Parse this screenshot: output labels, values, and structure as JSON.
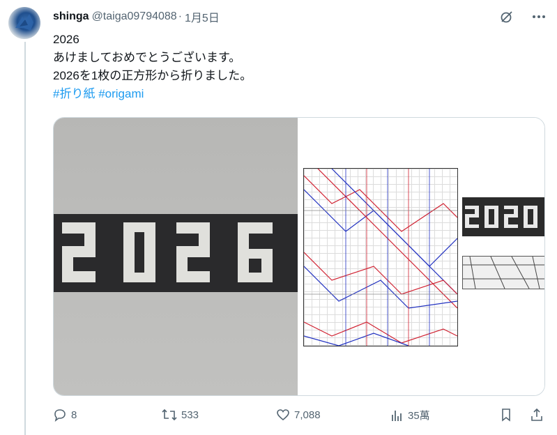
{
  "tweet": {
    "display_name": "shinga",
    "handle": "@taiga09794088",
    "separator": "·",
    "date": "1月5日",
    "lines": [
      "2026",
      "あけましておめでとうございます。",
      "2026を1枚の正方形から折りました。"
    ],
    "hashtags": [
      "#折り紙",
      "#origami"
    ]
  },
  "actions": {
    "replies": "8",
    "retweets": "533",
    "likes": "7,088",
    "views": "35萬"
  },
  "icons": {
    "grok": "grok-icon",
    "more": "more-icon",
    "reply": "reply-icon",
    "retweet": "retweet-icon",
    "like": "heart-icon",
    "views": "views-icon",
    "bookmark": "bookmark-icon",
    "share": "share-icon"
  },
  "colors": {
    "link": "#1d9bf0",
    "muted": "#536471",
    "text": "#0f1419"
  }
}
